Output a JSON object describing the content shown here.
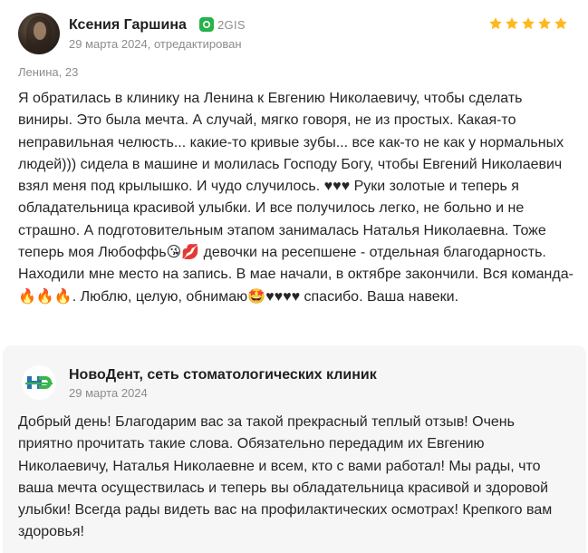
{
  "review": {
    "author": "Ксения Гаршина",
    "source": "2GIS",
    "source_icon": "2gis-icon",
    "date": "29 марта 2024, отредактирован",
    "rating": 5,
    "star_color": "#ffb81c",
    "branch": "Ленина, 23",
    "text": "Я обратилась в клинику на Ленина к Евгению Николаевичу, чтобы сделать виниры. Это была мечта. А случай, мягко говоря, не из простых. Какая-то неправильная челюсть... какие-то кривые зубы... все как-то не как у нормальных людей))) сидела в машине и молилась Господу Богу, чтобы Евгений Николаевич взял меня под крылышко. И чудо случилось. ♥♥♥ Руки золотые и теперь я обладательница красивой улыбки. И все получилось легко, не больно и не страшно. А подготовительным этапом занималась Наталья Николаевна. Тоже теперь моя Любоффь😘💋 девочки на ресепшене - отдельная благодарность. Находили мне место на запись. В мае начали, в октябре закончили. Вся команда- 🔥🔥🔥. Люблю, целую, обнимаю🤩♥♥♥♥ спасибо. Ваша навеки."
  },
  "reply": {
    "author": "НовоДент, сеть стоматологических клиник",
    "logo_icon": "novodent-logo-icon",
    "date": "29 марта 2024",
    "text": "Добрый день! Благодарим вас за такой прекрасный теплый отзыв! Очень приятно прочитать такие слова. Обязательно передадим их Евгению Николаевичу, Наталья Николаевне и всем, кто с вами работал! Мы рады, что ваша мечта осуществилась и теперь вы обладательница красивой и здоровой улыбки! Всегда рады видеть вас на профилактических осмотрах! Крепкого вам здоровья!"
  },
  "colors": {
    "reply_background": "#f6f6f6",
    "secondary_text": "#8c8c8c",
    "brand_green": "#29b24c",
    "logo_blue": "#2a6fb0"
  }
}
